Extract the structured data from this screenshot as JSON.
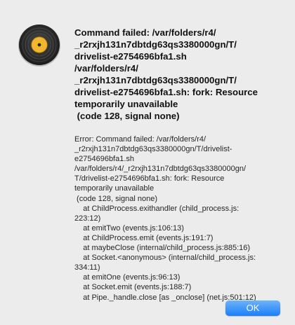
{
  "dialog": {
    "icon": "vinyl-record-app-icon",
    "title": "Command failed: /var/folders/r4/\n_r2rxjh131n7dbtdg63qs3380000gn/T/\ndrivelist-e2754696bfa1.sh\n/var/folders/r4/\n_r2rxjh131n7dbtdg63qs3380000gn/T/\ndrivelist-e2754696bfa1.sh: fork: Resource\ntemporarily unavailable\n (code 128, signal none)",
    "details": "Error: Command failed: /var/folders/r4/\n_r2rxjh131n7dbtdg63qs3380000gn/T/drivelist-\ne2754696bfa1.sh\n/var/folders/r4/_r2rxjh131n7dbtdg63qs3380000gn/\nT/drivelist-e2754696bfa1.sh: fork: Resource\ntemporarily unavailable\n (code 128, signal none)\n    at ChildProcess.exithandler (child_process.js:\n223:12)\n    at emitTwo (events.js:106:13)\n    at ChildProcess.emit (events.js:191:7)\n    at maybeClose (internal/child_process.js:885:16)\n    at Socket.<anonymous> (internal/child_process.js:\n334:11)\n    at emitOne (events.js:96:13)\n    at Socket.emit (events.js:188:7)\n    at Pipe._handle.close [as _onclose] (net.js:501:12)",
    "ok_label": "OK",
    "accent_color": "#1b7ff8"
  }
}
